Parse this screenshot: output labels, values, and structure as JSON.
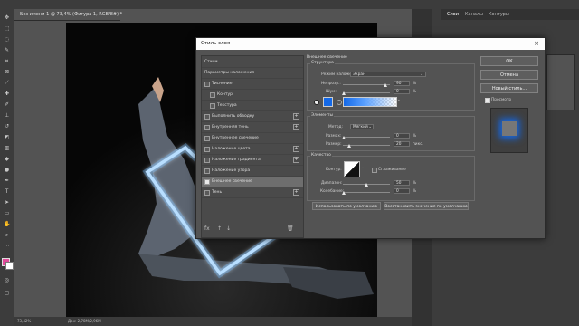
{
  "document_tab": {
    "title": "Без имени-1 @ 73,4% (Фигура 1, RGB/8#) *",
    "close": "×"
  },
  "status": {
    "zoom": "73,42%",
    "doc_info": "Док: 2,78М/2,96М"
  },
  "right_panel": {
    "tabs": [
      "Слои",
      "Каналы",
      "Контуры"
    ]
  },
  "dialog": {
    "title": "Стиль слоя",
    "close": "×",
    "styles": [
      {
        "label": "Стили",
        "checkbox": false,
        "checked": false,
        "plus": false,
        "indent": false,
        "selected": false
      },
      {
        "label": "Параметры наложения",
        "checkbox": false,
        "checked": false,
        "plus": false,
        "indent": false,
        "selected": false
      },
      {
        "label": "Тиснение",
        "checkbox": true,
        "checked": false,
        "plus": false,
        "indent": false,
        "selected": false
      },
      {
        "label": "Контур",
        "checkbox": true,
        "checked": false,
        "plus": false,
        "indent": true,
        "selected": false
      },
      {
        "label": "Текстура",
        "checkbox": true,
        "checked": false,
        "plus": false,
        "indent": true,
        "selected": false
      },
      {
        "label": "Выполнить обводку",
        "checkbox": true,
        "checked": false,
        "plus": true,
        "indent": false,
        "selected": false
      },
      {
        "label": "Внутренняя тень",
        "checkbox": true,
        "checked": false,
        "plus": true,
        "indent": false,
        "selected": false
      },
      {
        "label": "Внутреннее свечение",
        "checkbox": true,
        "checked": false,
        "plus": false,
        "indent": false,
        "selected": false
      },
      {
        "label": "Наложение цвета",
        "checkbox": true,
        "checked": false,
        "plus": true,
        "indent": false,
        "selected": false
      },
      {
        "label": "Наложение градиента",
        "checkbox": true,
        "checked": false,
        "plus": true,
        "indent": false,
        "selected": false
      },
      {
        "label": "Наложение узора",
        "checkbox": true,
        "checked": false,
        "plus": false,
        "indent": false,
        "selected": false
      },
      {
        "label": "Внешнее свечение",
        "checkbox": true,
        "checked": true,
        "plus": false,
        "indent": false,
        "selected": true
      },
      {
        "label": "Тень",
        "checkbox": true,
        "checked": false,
        "plus": true,
        "indent": false,
        "selected": false
      }
    ],
    "footer_icons": [
      "fx",
      "↑",
      "↓",
      "🗑"
    ],
    "outer_glow": {
      "heading": "Внешнее свечение",
      "structure": {
        "title": "Структура",
        "blend_mode_label": "Режим наложения:",
        "blend_mode_value": "Экран",
        "opacity_label": "Непрозр.:",
        "opacity_value": "90",
        "noise_label": "Шум:",
        "noise_value": "0",
        "percent": "%",
        "glow_color": "#1469e8"
      },
      "elements": {
        "title": "Элементы",
        "method_label": "Метод:",
        "method_value": "Мягкий",
        "spread_label": "Размах:",
        "spread_value": "0",
        "size_label": "Размер:",
        "size_value": "20",
        "px": "пикс.",
        "percent": "%"
      },
      "quality": {
        "title": "Качество",
        "contour_label": "Контур:",
        "antialias_label": "Сглаживание",
        "range_label": "Диапазон:",
        "range_value": "50",
        "jitter_label": "Колебание:",
        "jitter_value": "0",
        "percent": "%"
      },
      "make_default": "Использовать по умолчанию",
      "reset_default": "Восстановить значения по умолчанию"
    },
    "buttons": {
      "ok": "ОК",
      "cancel": "Отмена",
      "new_style": "Новый стиль...",
      "preview_label": "Просмотр"
    }
  },
  "glow_color": "#7fc8ff"
}
